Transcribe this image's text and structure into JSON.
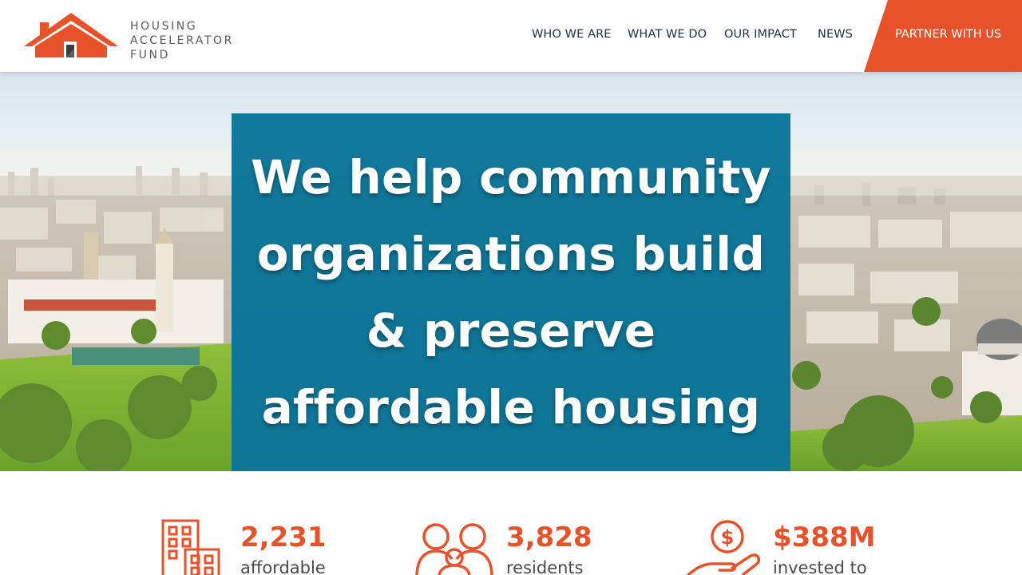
{
  "brand": {
    "logo_line1": "HOUSING",
    "logo_line2": "ACCELERATOR",
    "logo_line3": "FUND",
    "accent_color": "#E8522B",
    "hero_color": "#087498"
  },
  "nav": {
    "items": [
      {
        "label": "WHO WE ARE"
      },
      {
        "label": "WHAT WE DO"
      },
      {
        "label": "OUR IMPACT"
      },
      {
        "label": "NEWS"
      }
    ],
    "cta_label": "PARTNER WITH US"
  },
  "hero": {
    "heading_line1": "We help community",
    "heading_line2": "organizations build",
    "heading_line3": "& preserve",
    "heading_line4": "affordable housing"
  },
  "stats": [
    {
      "icon": "building-icon",
      "number": "2,231",
      "label": "affordable"
    },
    {
      "icon": "people-icon",
      "number": "3,828",
      "label": "residents"
    },
    {
      "icon": "hand-coin-icon",
      "number": "$388M",
      "label": "invested to"
    }
  ]
}
